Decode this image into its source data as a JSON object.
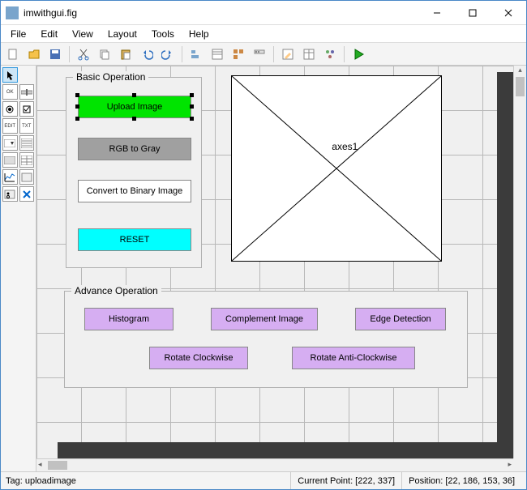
{
  "window": {
    "title": "imwithgui.fig"
  },
  "menu": {
    "file": "File",
    "edit": "Edit",
    "view": "View",
    "layout": "Layout",
    "tools": "Tools",
    "help": "Help"
  },
  "toolbar_icons": {
    "new": "new-file-icon",
    "open": "open-icon",
    "save": "save-icon",
    "cut": "cut-icon",
    "copy": "copy-icon",
    "paste": "paste-icon",
    "undo": "undo-icon",
    "redo": "redo-icon",
    "align": "align-icon",
    "distribute": "distribute-icon",
    "meditor": "menu-editor-icon",
    "torder": "tab-order-icon",
    "tbeditor": "toolbar-editor-icon",
    "editor": "editor-icon",
    "propinsp": "prop-inspector-icon",
    "objbrowse": "obj-browser-icon",
    "run": "run-icon"
  },
  "palette": {
    "select": "Select",
    "push": "OK",
    "slider": "Slider",
    "radio": "Radio",
    "check": "Check",
    "edit": "EDIT",
    "text": "TXT",
    "popup": "Popup",
    "listbox": "List",
    "toggle": "Tgl",
    "table": "Tbl",
    "axes": "Axe",
    "panel": "Pnl",
    "bgroup": "Grp",
    "activex": "✘"
  },
  "basic": {
    "legend": "Basic Operation",
    "upload": "Upload Image",
    "gray": "RGB to Gray",
    "binary": "Convert to Binary Image",
    "reset": "RESET"
  },
  "axes": {
    "label": "axes1"
  },
  "advance": {
    "legend": "Advance Operation",
    "hist": "Histogram",
    "comp": "Complement Image",
    "edge": "Edge Detection",
    "rotc": "Rotate Clockwise",
    "rota": "Rotate Anti-Clockwise"
  },
  "status": {
    "tag": "Tag: uploadimage",
    "cp": "Current Point:  [222, 337]",
    "pos": "Position: [22, 186, 153, 36]"
  }
}
